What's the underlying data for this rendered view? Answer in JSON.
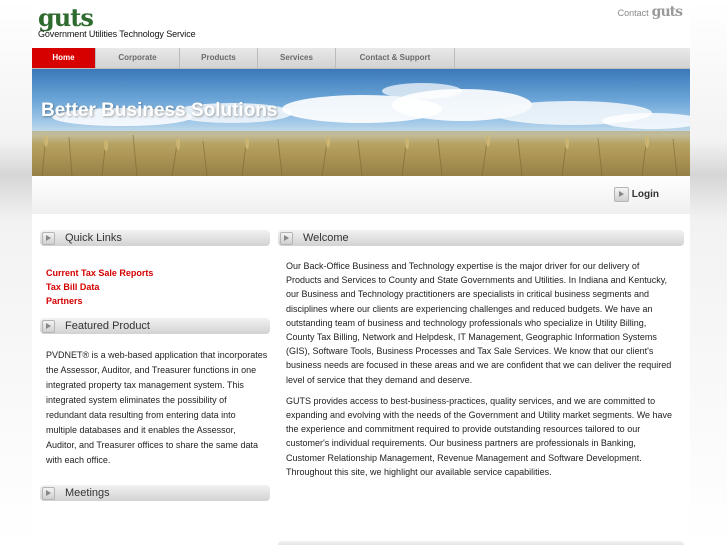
{
  "header": {
    "logo_word": "guts",
    "logo_subtitle": "Government Utilities Technology Service",
    "contact_label": "Contact",
    "contact_brand": "guts"
  },
  "nav": {
    "items": [
      {
        "label": "Home",
        "active": true
      },
      {
        "label": "Corporate",
        "active": false
      },
      {
        "label": "Products",
        "active": false
      },
      {
        "label": "Services",
        "active": false
      },
      {
        "label": "Contact & Support",
        "active": false
      },
      {
        "label": "",
        "active": false
      }
    ]
  },
  "banner": {
    "title": "Better Business Solutions"
  },
  "login": {
    "label": "Login"
  },
  "quick_links": {
    "title": "Quick Links",
    "links": [
      "Current Tax Sale Reports",
      "Tax Bill Data",
      "Partners"
    ]
  },
  "featured": {
    "title": "Featured Product",
    "text": "PVDNET® is a web-based application that incorporates the Assessor, Auditor, and Treasurer functions in one integrated property tax management system.  This integrated system eliminates the possibility of redundant data resulting from entering data into multiple databases and it enables the Assessor, Auditor, and Treasurer offices to share the same data with each office."
  },
  "meetings": {
    "title": "Meetings"
  },
  "welcome": {
    "title": "Welcome",
    "paragraph1": "Our Back-Office Business and Technology expertise is the major driver for our delivery of Products and Services to County and State Governments and Utilities. In Indiana and Kentucky, our Business and Technology practitioners are specialists in critical business segments and disciplines where our clients are experiencing challenges and reduced budgets. We have an outstanding team of business and technology professionals who specialize in Utility Billing, County Tax Billing, Network and Helpdesk, IT Management, Geographic Information Systems (GIS), Software Tools, Business Processes and Tax Sale Services. We know that our client's business needs are focused in these areas and we are confident that we can deliver the required level of service that they demand and deserve.",
    "paragraph2": "GUTS provides access to best-business-practices, quality services, and we are committed to expanding and evolving with the needs of the Government and Utility market segments. We have the experience and commitment required to provide outstanding resources tailored to our customer's individual requirements. Our business partners are professionals in Banking, Customer Relationship Management, Revenue Management and Software Development. Throughout this site, we highlight our available service capabilities."
  },
  "colors": {
    "accent_red": "#d60000",
    "logo_green": "#2f6b2f"
  },
  "icons": {
    "panel_bullet": "arrow-bullet-icon"
  }
}
